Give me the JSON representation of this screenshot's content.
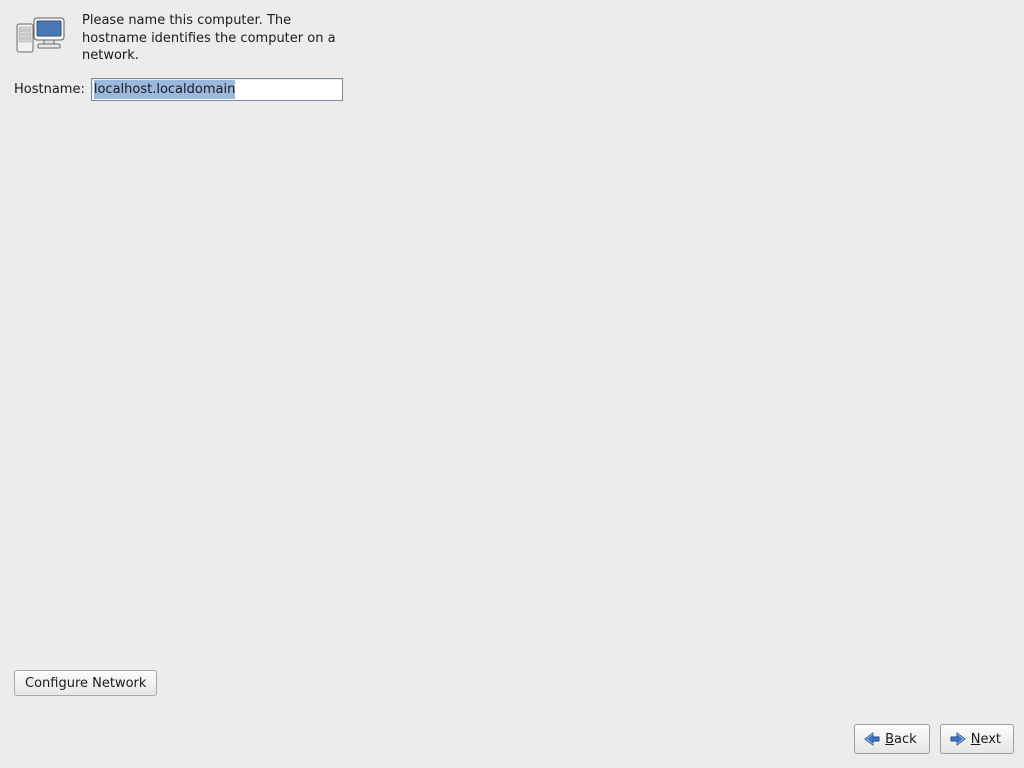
{
  "description": "Please name this computer.  The hostname identifies the computer on a network.",
  "form": {
    "hostname_label": "Hostname:",
    "hostname_value": "localhost.localdomain"
  },
  "buttons": {
    "configure_network": "Configure Network",
    "back_mnemonic": "B",
    "back_rest": "ack",
    "next_mnemonic": "N",
    "next_rest": "ext"
  },
  "icons": {
    "header": "network-computers-icon",
    "back": "arrow-left-icon",
    "next": "arrow-right-icon"
  }
}
